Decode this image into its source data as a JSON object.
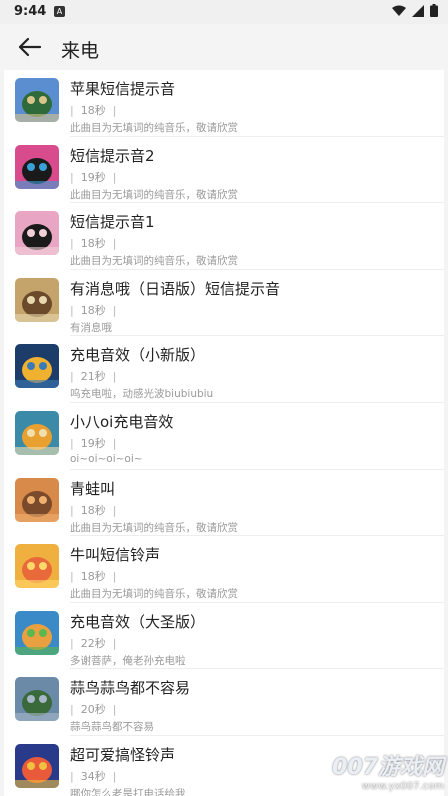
{
  "status_bar": {
    "time": "9:44",
    "app_icon": "A"
  },
  "header": {
    "title": "来电"
  },
  "items": [
    {
      "name": "苹果短信提示音",
      "duration": "18秒",
      "desc": "此曲目为无填词的纯音乐，敬请欣赏",
      "thumb": [
        "#5b8ed1",
        "#2f6b3a",
        "#d9c48a"
      ]
    },
    {
      "name": "短信提示音2",
      "duration": "19秒",
      "desc": "此曲目为无填词的纯音乐，敬请欣赏",
      "thumb": [
        "#d84c8e",
        "#1a1a1a",
        "#3aa0d8"
      ]
    },
    {
      "name": "短信提示音1",
      "duration": "18秒",
      "desc": "此曲目为无填词的纯音乐，敬请欣赏",
      "thumb": [
        "#e8a6c4",
        "#1a1a1a",
        "#f0d0d8"
      ]
    },
    {
      "name": "有消息哦（日语版）短信提示音",
      "duration": "18秒",
      "desc": "有消息哦",
      "thumb": [
        "#c4a46a",
        "#6a4a2a",
        "#e8d8b0"
      ]
    },
    {
      "name": "充电音效（小新版）",
      "duration": "21秒",
      "desc": "呜充电啦，动感光波biubiubiu",
      "thumb": [
        "#1c3c6a",
        "#f0b030",
        "#3a7ab8"
      ]
    },
    {
      "name": "小八oi充电音效",
      "duration": "19秒",
      "desc": "oi~oi~oi~oi~",
      "thumb": [
        "#3a8aa8",
        "#e8a030",
        "#f0e0b0"
      ]
    },
    {
      "name": "青蛙叫",
      "duration": "18秒",
      "desc": "此曲目为无填词的纯音乐，敬请欣赏",
      "thumb": [
        "#d88a4a",
        "#7a4a2a",
        "#f0b070"
      ]
    },
    {
      "name": "牛叫短信铃声",
      "duration": "18秒",
      "desc": "此曲目为无填词的纯音乐，敬请欣赏",
      "thumb": [
        "#f0b040",
        "#e86a3a",
        "#ffd86a"
      ]
    },
    {
      "name": "充电音效（大圣版）",
      "duration": "22秒",
      "desc": "多谢菩萨，俺老孙充电啦",
      "thumb": [
        "#3a8ac8",
        "#e8a040",
        "#5ab850"
      ]
    },
    {
      "name": "蒜鸟蒜鸟都不容易",
      "duration": "20秒",
      "desc": "蒜鸟蒜鸟都不容易",
      "thumb": [
        "#6a8aa8",
        "#3a6a3a",
        "#a8b8c8"
      ]
    },
    {
      "name": "超可爱搞怪铃声",
      "duration": "34秒",
      "desc": "哪你怎么老是打电话给我",
      "thumb": [
        "#2a3a8a",
        "#e85a3a",
        "#f0c040"
      ]
    }
  ],
  "watermark": {
    "main": "007游戏网",
    "sub": "www.yx007.com"
  }
}
